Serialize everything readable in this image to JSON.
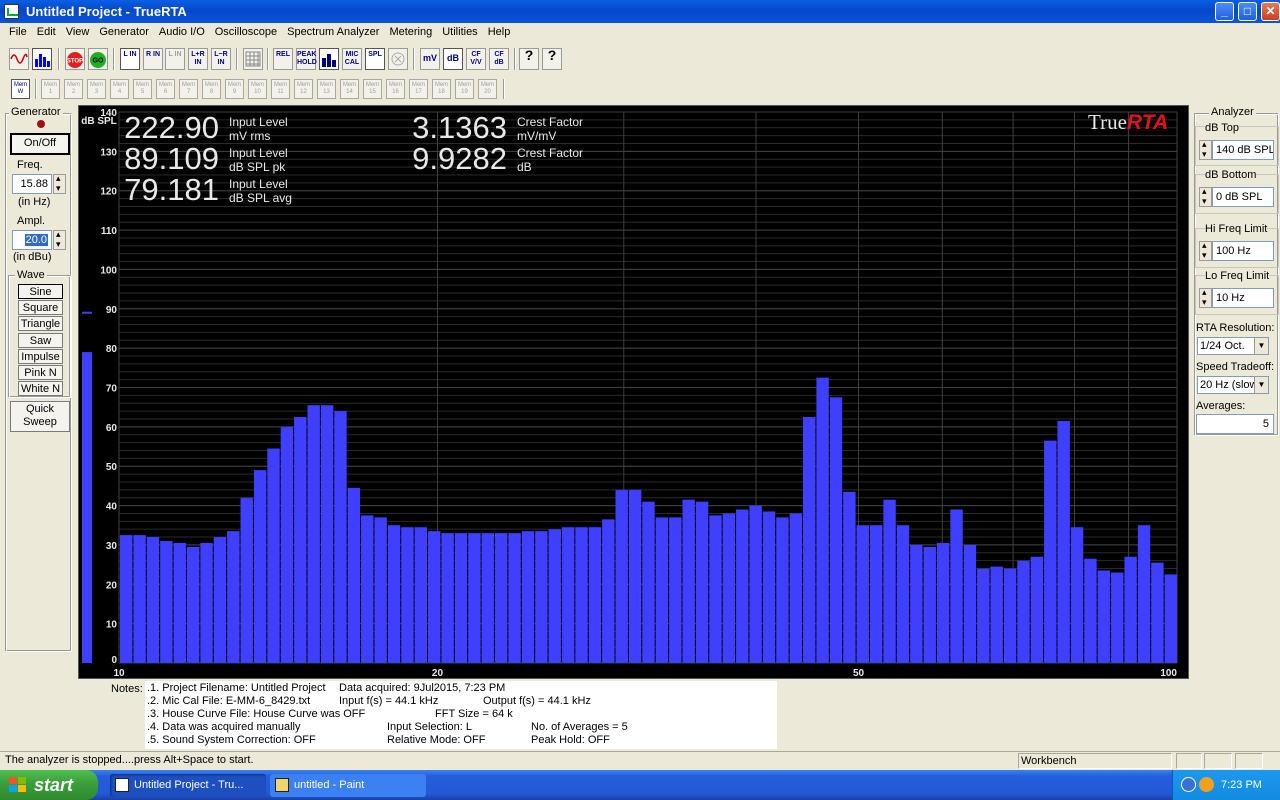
{
  "window": {
    "title": "Untitled Project - TrueRTA",
    "minimize": "_",
    "maximize": "□",
    "close": "✕"
  },
  "menu": [
    "File",
    "Edit",
    "View",
    "Generator",
    "Audio I/O",
    "Oscilloscope",
    "Spectrum Analyzer",
    "Metering",
    "Utilities",
    "Help"
  ],
  "toolbar": {
    "channel_buttons": [
      "L IN",
      "R IN",
      "L IN",
      "L+R IN",
      "L−R IN"
    ],
    "mode_buttons": [
      "REL",
      "PEAK HOLD",
      "MIC CAL",
      "SPL"
    ],
    "unit_buttons": [
      "mV",
      "dB",
      "CF V/V",
      "CF dB"
    ],
    "stop_label": "STOP",
    "go_label": "GO",
    "help_label": "?",
    "context_help_label": "?"
  },
  "memory_bar": {
    "active": "Mem W",
    "slots": [
      "Mem 1",
      "Mem 2",
      "Mem 3",
      "Mem 4",
      "Mem 5",
      "Mem 6",
      "Mem 7",
      "Mem 8",
      "Mem 9",
      "Mem 10",
      "Mem 11",
      "Mem 12",
      "Mem 13",
      "Mem 14",
      "Mem 15",
      "Mem 16",
      "Mem 17",
      "Mem 18",
      "Mem 19",
      "Mem 20"
    ]
  },
  "generator": {
    "title": "Generator",
    "on_off": "On/Off",
    "freq_label": "Freq.",
    "freq_value": "15.88",
    "freq_unit": "(in Hz)",
    "ampl_label": "Ampl.",
    "ampl_value": "20.0",
    "ampl_unit": "(in dBu)",
    "wave_label": "Wave",
    "waves": [
      "Sine",
      "Square",
      "Triangle",
      "Saw",
      "Impulse",
      "Pink N",
      "White N"
    ],
    "selected_wave": "Sine",
    "quick_sweep": "Quick Sweep"
  },
  "analyzer": {
    "title": "Analyzer",
    "db_top_label": "dB Top",
    "db_top_value": "140 dB SPL",
    "db_bottom_label": "dB Bottom",
    "db_bottom_value": "0 dB SPL",
    "hi_freq_label": "Hi Freq Limit",
    "hi_freq_value": "100 Hz",
    "lo_freq_label": "Lo Freq Limit",
    "lo_freq_value": "10 Hz",
    "resolution_label": "RTA Resolution:",
    "resolution_value": "1/24 Oct.",
    "speed_label": "Speed Tradeoff:",
    "speed_value": "20 Hz (slow)",
    "averages_label": "Averages:",
    "averages_value": "5"
  },
  "readouts": [
    {
      "value": "222.90",
      "line1": "Input Level",
      "line2": "mV rms"
    },
    {
      "value": "89.109",
      "line1": "Input Level",
      "line2": "dB SPL pk"
    },
    {
      "value": "79.181",
      "line1": "Input Level",
      "line2": "dB SPL avg"
    },
    {
      "value": "3.1363",
      "line1": "Crest Factor",
      "line2": "mV/mV"
    },
    {
      "value": "9.9282",
      "line1": "Crest Factor",
      "line2": "dB"
    }
  ],
  "brand": {
    "part1": "True",
    "part2": "RTA"
  },
  "colors": {
    "bar": "#3f3fff",
    "plot_bg": "#000000",
    "grid": "#404040",
    "brand_red": "#e0141e"
  },
  "chart_data": {
    "type": "bar",
    "ylabel": "dB SPL",
    "ylim": [
      0,
      140
    ],
    "yticks": [
      0,
      10,
      20,
      30,
      40,
      50,
      60,
      70,
      80,
      90,
      100,
      110,
      120,
      130,
      140
    ],
    "xscale": "log",
    "xlim": [
      10,
      100
    ],
    "xtick_labels": [
      "10",
      "20",
      "50",
      "100"
    ],
    "xticks": [
      10,
      20,
      50,
      100
    ],
    "grid": true,
    "level_meter": {
      "avg": 79,
      "peak": 89
    },
    "values": [
      32.5,
      32.5,
      32,
      31,
      30.5,
      29.5,
      30.5,
      32,
      33.5,
      42,
      49,
      54.5,
      60,
      62.5,
      65.5,
      65.5,
      64,
      44.5,
      37.5,
      37,
      35,
      34.5,
      34.5,
      33.5,
      33,
      33,
      33,
      33,
      33,
      33,
      33.5,
      33.5,
      34,
      34.5,
      34.5,
      34.5,
      36.5,
      44,
      44,
      41,
      37,
      37,
      41.5,
      41,
      37.5,
      38,
      39,
      40,
      38.5,
      37,
      38,
      62.5,
      72.5,
      67.5,
      43.5,
      35,
      35,
      41.5,
      35,
      30,
      29.5,
      30.5,
      39,
      30,
      24,
      24.5,
      24,
      26,
      27,
      56.5,
      61.5,
      34.5,
      26.5,
      23.5,
      23,
      27,
      35,
      25.5,
      22.5
    ]
  },
  "notes": {
    "label": "Notes:",
    "lines": [
      ".1. Project Filename: Untitled Project",
      ".2. Mic Cal File: E-MM-6_8429.txt",
      ".3. House Curve File: House Curve was OFF",
      ".4. Data was acquired manually",
      ".5. Sound System Correction: OFF"
    ],
    "data_acquired": "Data acquired: 9Jul2015, 7:23 PM",
    "input_fs": "Input f(s) = 44.1 kHz",
    "output_fs": "Output f(s) = 44.1 kHz",
    "fft_size": "FFT Size = 64 k",
    "input_selection": "Input Selection: L",
    "num_averages": "No. of Averages = 5",
    "relative_mode": "Relative Mode:  OFF",
    "peak_hold": "Peak Hold: OFF"
  },
  "status": {
    "message": "The analyzer is stopped....press Alt+Space to start.",
    "panel": "Workbench"
  },
  "taskbar": {
    "start": "start",
    "tasks": [
      {
        "label": "Untitled Project - Tru...",
        "active": true
      },
      {
        "label": "untitled - Paint",
        "active": false
      }
    ],
    "clock": "7:23 PM"
  }
}
